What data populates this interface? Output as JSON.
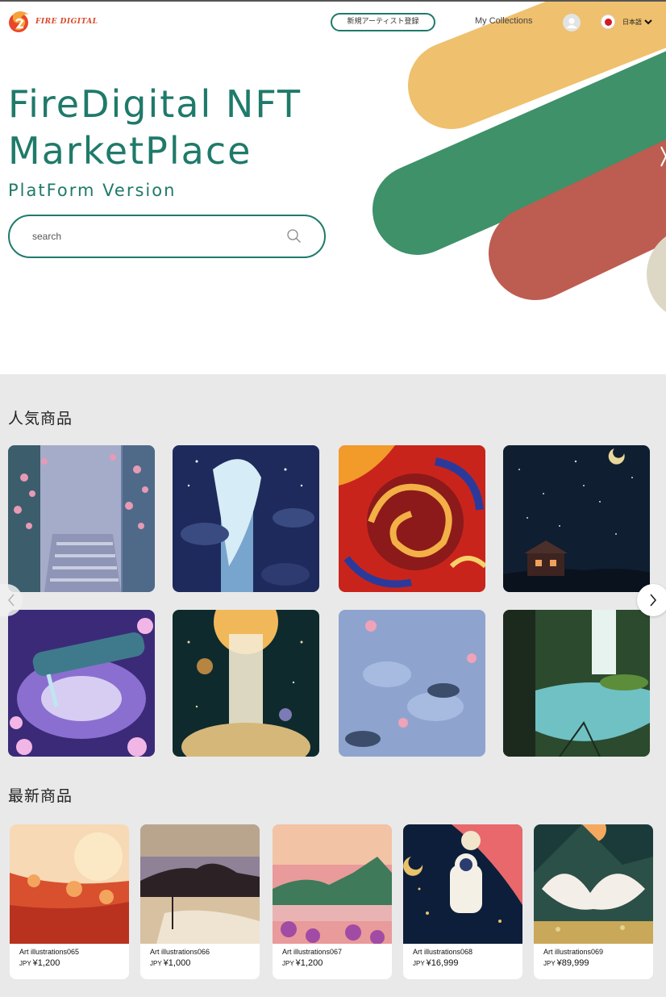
{
  "brand": {
    "name": "FIRE DIGITAL"
  },
  "header": {
    "register_label": "新規アーティスト登録",
    "collections_label": "My Collections",
    "language_label": "日本語"
  },
  "hero": {
    "title_line1": "FireDigital NFT",
    "title_line2": "MarketPlace",
    "subtitle": "PlatForm Version",
    "search_placeholder": "search"
  },
  "popular": {
    "title": "人気商品",
    "items": [
      {
        "icon": "rose-staircase-artwork"
      },
      {
        "icon": "whale-night-artwork"
      },
      {
        "icon": "red-swirl-artwork"
      },
      {
        "icon": "starry-cabin-artwork"
      },
      {
        "icon": "pipe-water-artwork"
      },
      {
        "icon": "moon-waterfall-artwork"
      },
      {
        "icon": "lotus-pond-artwork"
      },
      {
        "icon": "forest-waterfall-artwork"
      }
    ]
  },
  "latest": {
    "title": "最新商品",
    "items": [
      {
        "name": "Art illustrations065",
        "currency": "JPY",
        "price": "¥1,200"
      },
      {
        "name": "Art illustrations066",
        "currency": "JPY",
        "price": "¥1,000"
      },
      {
        "name": "Art illustrations067",
        "currency": "JPY",
        "price": "¥1,200"
      },
      {
        "name": "Art illustrations068",
        "currency": "JPY",
        "price": "¥16,999"
      },
      {
        "name": "Art illustrations069",
        "currency": "JPY",
        "price": "¥89,999"
      }
    ]
  },
  "colors": {
    "accent": "#1f7a6a",
    "brand_red": "#d9482b",
    "stripe_yellow": "#efc06d",
    "stripe_green": "#3e9169",
    "stripe_red": "#bd5c50",
    "section_bg": "#e9e9e9"
  }
}
